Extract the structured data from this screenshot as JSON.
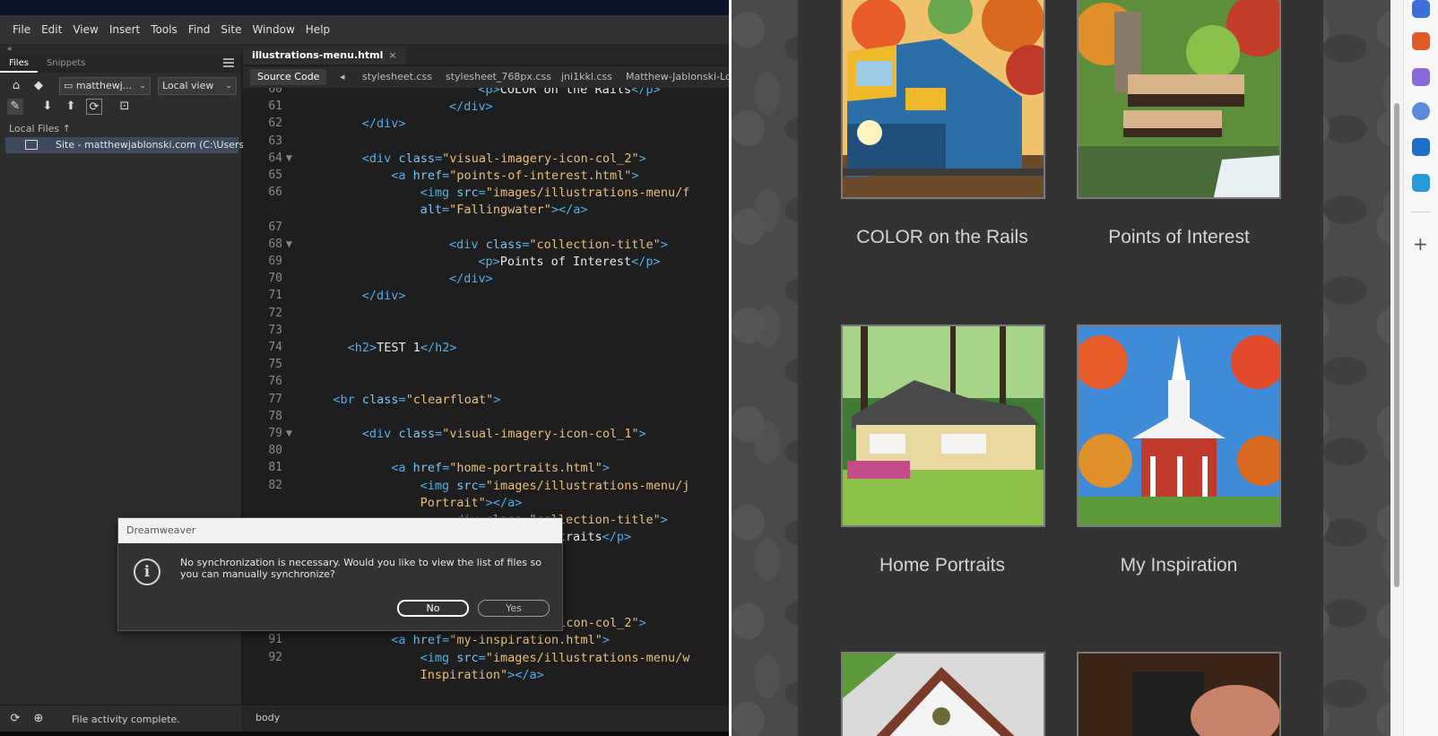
{
  "dreamweaver": {
    "menu": [
      "File",
      "Edit",
      "View",
      "Insert",
      "Tools",
      "Find",
      "Site",
      "Window",
      "Help"
    ],
    "files_panel": {
      "tabs": [
        "Files",
        "Snippets"
      ],
      "site_dropdown": "matthewj...",
      "view_dropdown": "Local view",
      "local_files_label": "Local Files",
      "site_row": "Site - matthewjablonski.com (C:\\Users\\...",
      "status": "File activity complete."
    },
    "document_tab": "illustrations-menu.html",
    "related_files": [
      "Source Code",
      "stylesheet.css",
      "stylesheet_768px.css",
      "jni1kkl.css",
      "Matthew-Jablonski-Logo"
    ],
    "tag_selector": "body",
    "code_lines": [
      {
        "n": "60",
        "indent": 24,
        "parts": [
          [
            "tg",
            "<p>"
          ],
          [
            "tx",
            "COLOR on the Rails"
          ],
          [
            "tg",
            "</p>"
          ]
        ]
      },
      {
        "n": "61",
        "indent": 20,
        "parts": [
          [
            "tg",
            "</div>"
          ]
        ]
      },
      {
        "n": "62",
        "indent": 8,
        "parts": [
          [
            "tg",
            "</div>"
          ]
        ]
      },
      {
        "n": "63",
        "indent": 0,
        "parts": []
      },
      {
        "n": "64",
        "indent": 8,
        "fold": true,
        "parts": [
          [
            "tg",
            "<div "
          ],
          [
            "at",
            "class"
          ],
          [
            "tg",
            "="
          ],
          [
            "st",
            "\"visual-imagery-icon-col_2\""
          ],
          [
            "tg",
            ">"
          ]
        ]
      },
      {
        "n": "65",
        "indent": 12,
        "parts": [
          [
            "tg",
            "<a "
          ],
          [
            "at",
            "href"
          ],
          [
            "tg",
            "="
          ],
          [
            "st",
            "\"points-of-interest.html\""
          ],
          [
            "tg",
            ">"
          ]
        ]
      },
      {
        "n": "66",
        "indent": 16,
        "parts": [
          [
            "tg",
            "<img "
          ],
          [
            "at",
            "src"
          ],
          [
            "tg",
            "="
          ],
          [
            "st",
            "\"images/illustrations-menu/f"
          ]
        ]
      },
      {
        "n": "",
        "indent": 16,
        "parts": [
          [
            "at",
            "alt"
          ],
          [
            "tg",
            "="
          ],
          [
            "st",
            "\"Fallingwater\""
          ],
          [
            "tg",
            "></a>"
          ]
        ]
      },
      {
        "n": "67",
        "indent": 0,
        "parts": []
      },
      {
        "n": "68",
        "indent": 20,
        "fold": true,
        "parts": [
          [
            "tg",
            "<div "
          ],
          [
            "at",
            "class"
          ],
          [
            "tg",
            "="
          ],
          [
            "st",
            "\"collection-title\""
          ],
          [
            "tg",
            ">"
          ]
        ]
      },
      {
        "n": "69",
        "indent": 24,
        "parts": [
          [
            "tg",
            "<p>"
          ],
          [
            "tx",
            "Points of Interest"
          ],
          [
            "tg",
            "</p>"
          ]
        ]
      },
      {
        "n": "70",
        "indent": 20,
        "parts": [
          [
            "tg",
            "</div>"
          ]
        ]
      },
      {
        "n": "71",
        "indent": 8,
        "parts": [
          [
            "tg",
            "</div>"
          ]
        ]
      },
      {
        "n": "72",
        "indent": 0,
        "parts": []
      },
      {
        "n": "73",
        "indent": 0,
        "parts": []
      },
      {
        "n": "74",
        "indent": 6,
        "parts": [
          [
            "tg",
            "<h2>"
          ],
          [
            "tx",
            "TEST 1"
          ],
          [
            "tg",
            "</h2>"
          ]
        ]
      },
      {
        "n": "75",
        "indent": 0,
        "parts": []
      },
      {
        "n": "76",
        "indent": 0,
        "parts": []
      },
      {
        "n": "77",
        "indent": 4,
        "parts": [
          [
            "tg",
            "<br "
          ],
          [
            "at",
            "class"
          ],
          [
            "tg",
            "="
          ],
          [
            "st",
            "\"clearfloat\""
          ],
          [
            "tg",
            ">"
          ]
        ]
      },
      {
        "n": "78",
        "indent": 0,
        "parts": []
      },
      {
        "n": "79",
        "indent": 8,
        "fold": true,
        "parts": [
          [
            "tg",
            "<div "
          ],
          [
            "at",
            "class"
          ],
          [
            "tg",
            "="
          ],
          [
            "st",
            "\"visual-imagery-icon-col_1\""
          ],
          [
            "tg",
            ">"
          ]
        ]
      },
      {
        "n": "80",
        "indent": 0,
        "parts": []
      },
      {
        "n": "81",
        "indent": 12,
        "parts": [
          [
            "tg",
            "<a "
          ],
          [
            "at",
            "href"
          ],
          [
            "tg",
            "="
          ],
          [
            "st",
            "\"home-portraits.html\""
          ],
          [
            "tg",
            ">"
          ]
        ]
      },
      {
        "n": "82",
        "indent": 16,
        "parts": [
          [
            "tg",
            "<img "
          ],
          [
            "at",
            "src"
          ],
          [
            "tg",
            "="
          ],
          [
            "st",
            "\"images/illustrations-menu/j"
          ]
        ]
      },
      {
        "n": "",
        "indent": 16,
        "parts": [
          [
            "st",
            "Portrait\""
          ],
          [
            "tg",
            "></a>"
          ]
        ]
      },
      {
        "n": "",
        "indent": 20,
        "parts": [
          [
            "tg",
            "<div "
          ],
          [
            "at",
            "class"
          ],
          [
            "tg",
            "="
          ],
          [
            "st",
            "\"collection-title\""
          ],
          [
            "tg",
            ">"
          ]
        ]
      },
      {
        "n": "",
        "indent": 24,
        "parts": [
          [
            "tg",
            "<p>"
          ],
          [
            "tx",
            "Home Portraits"
          ],
          [
            "tg",
            "</p>"
          ]
        ]
      },
      {
        "n": "",
        "indent": 0,
        "parts": []
      },
      {
        "n": "",
        "indent": 0,
        "parts": []
      },
      {
        "n": "",
        "indent": 0,
        "parts": []
      },
      {
        "n": "89",
        "indent": 0,
        "parts": []
      },
      {
        "n": "90",
        "indent": 8,
        "fold": true,
        "parts": [
          [
            "tg",
            "<div "
          ],
          [
            "at",
            "class"
          ],
          [
            "tg",
            "="
          ],
          [
            "st",
            "\"visual-imagery-icon-col_2\""
          ],
          [
            "tg",
            ">"
          ]
        ]
      },
      {
        "n": "91",
        "indent": 12,
        "parts": [
          [
            "tg",
            "<a "
          ],
          [
            "at",
            "href"
          ],
          [
            "tg",
            "="
          ],
          [
            "st",
            "\"my-inspiration.html\""
          ],
          [
            "tg",
            ">"
          ]
        ]
      },
      {
        "n": "92",
        "indent": 16,
        "parts": [
          [
            "tg",
            "<img "
          ],
          [
            "at",
            "src"
          ],
          [
            "tg",
            "="
          ],
          [
            "st",
            "\"images/illustrations-menu/w"
          ]
        ]
      },
      {
        "n": "",
        "indent": 16,
        "parts": [
          [
            "st",
            "Inspiration\""
          ],
          [
            "tg",
            "></a>"
          ]
        ]
      }
    ]
  },
  "dialog": {
    "title": "Dreamweaver",
    "message": "No synchronization is necessary. Would you like to view the list of files so you can manually synchronize?",
    "no_label": "No",
    "yes_label": "Yes",
    "icon": "info-icon"
  },
  "website": {
    "cards": [
      {
        "title": "COLOR on the Rails",
        "image": "train-illustration"
      },
      {
        "title": "Points of Interest",
        "image": "fallingwater-illustration"
      },
      {
        "title": "Home Portraits",
        "image": "house-illustration"
      },
      {
        "title": "My Inspiration",
        "image": "church-illustration"
      },
      {
        "title": "",
        "image": "building-illustration"
      },
      {
        "title": "",
        "image": "hand-photo"
      }
    ]
  },
  "colors": {
    "dw_panel": "#2d2d2d",
    "code_bg": "#1e1e1e",
    "code_tag": "#55aee6",
    "code_string": "#e6c07b",
    "site_background": "#333333"
  }
}
